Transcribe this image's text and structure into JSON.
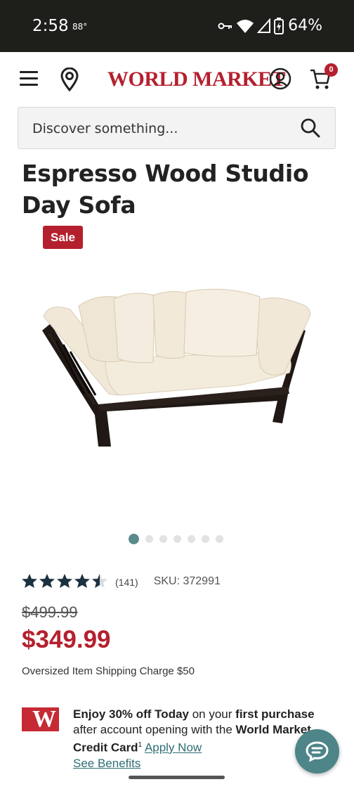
{
  "status_bar": {
    "time": "2:58",
    "temperature": "88°",
    "battery": "64%"
  },
  "header": {
    "logo_main": "WORLD MARKET",
    "cart_count": "0"
  },
  "search": {
    "placeholder": "Discover something..."
  },
  "product": {
    "title": "Espresso Wood Studio Day Sofa",
    "badge": "Sale",
    "image_count": 7,
    "active_image": 1,
    "rating": 4.5,
    "review_count": "(141)",
    "sku": "SKU: 372991",
    "old_price": "$499.99",
    "new_price": "$349.99",
    "shipping": "Oversized Item Shipping Charge $50"
  },
  "promo": {
    "logo_letter": "W",
    "line1_bold": "Enjoy 30% off Today",
    "line1_mid": " on your ",
    "line1_bold2": "first purchase",
    "line2": "after account opening with the ",
    "line2_bold": "World Market",
    "line3_bold": "Credit Card",
    "superscript": "1",
    "apply_link": "Apply Now",
    "benefits_link": "See Benefits"
  },
  "colors": {
    "brand_red": "#b5202e",
    "teal": "#4d8589",
    "link": "#2d6d74"
  }
}
